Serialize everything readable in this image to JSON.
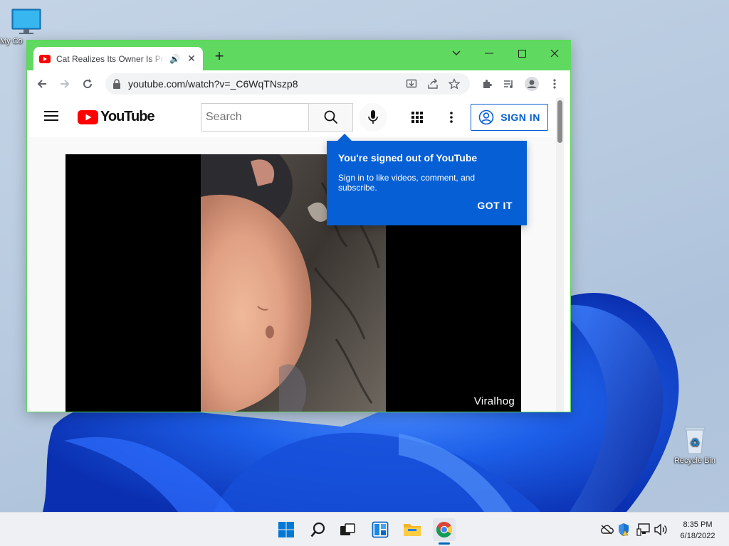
{
  "desktop": {
    "icons": [
      {
        "label": "My Co",
        "icon": "computer-icon"
      },
      {
        "label": "Recycle Bin",
        "icon": "recycle-bin-icon"
      }
    ]
  },
  "browser": {
    "tab": {
      "title": "Cat Realizes Its Owner Is Pregnant",
      "favicon": "youtube-favicon",
      "audio_icon": "🔊",
      "close_icon": "✕"
    },
    "new_tab_icon": "+",
    "window_controls": [
      "chevron-down-icon",
      "minimize-icon",
      "maximize-icon",
      "close-icon"
    ],
    "address_bar": {
      "url": "youtube.com/watch?v=_C6WqTNszp8"
    },
    "accent_color": "#5fd95f"
  },
  "youtube": {
    "logo_text": "YouTube",
    "search": {
      "placeholder": "Search"
    },
    "sign_in_label": "SIGN IN",
    "popup": {
      "title": "You're signed out of YouTube",
      "body": "Sign in to like videos, comment, and subscribe.",
      "button": "GOT IT"
    },
    "video": {
      "watermark": "Viralhog"
    },
    "brand_color": "#ff0000",
    "link_color": "#065fd4"
  },
  "taskbar": {
    "apps": [
      "windows-start-icon",
      "search-icon",
      "task-view-icon",
      "widgets-icon",
      "file-explorer-icon",
      "chrome-icon"
    ],
    "tray": [
      "onedrive-icon",
      "defender-icon",
      "network-icon",
      "volume-icon"
    ],
    "time": "8:35 PM",
    "date": "6/18/2022"
  }
}
